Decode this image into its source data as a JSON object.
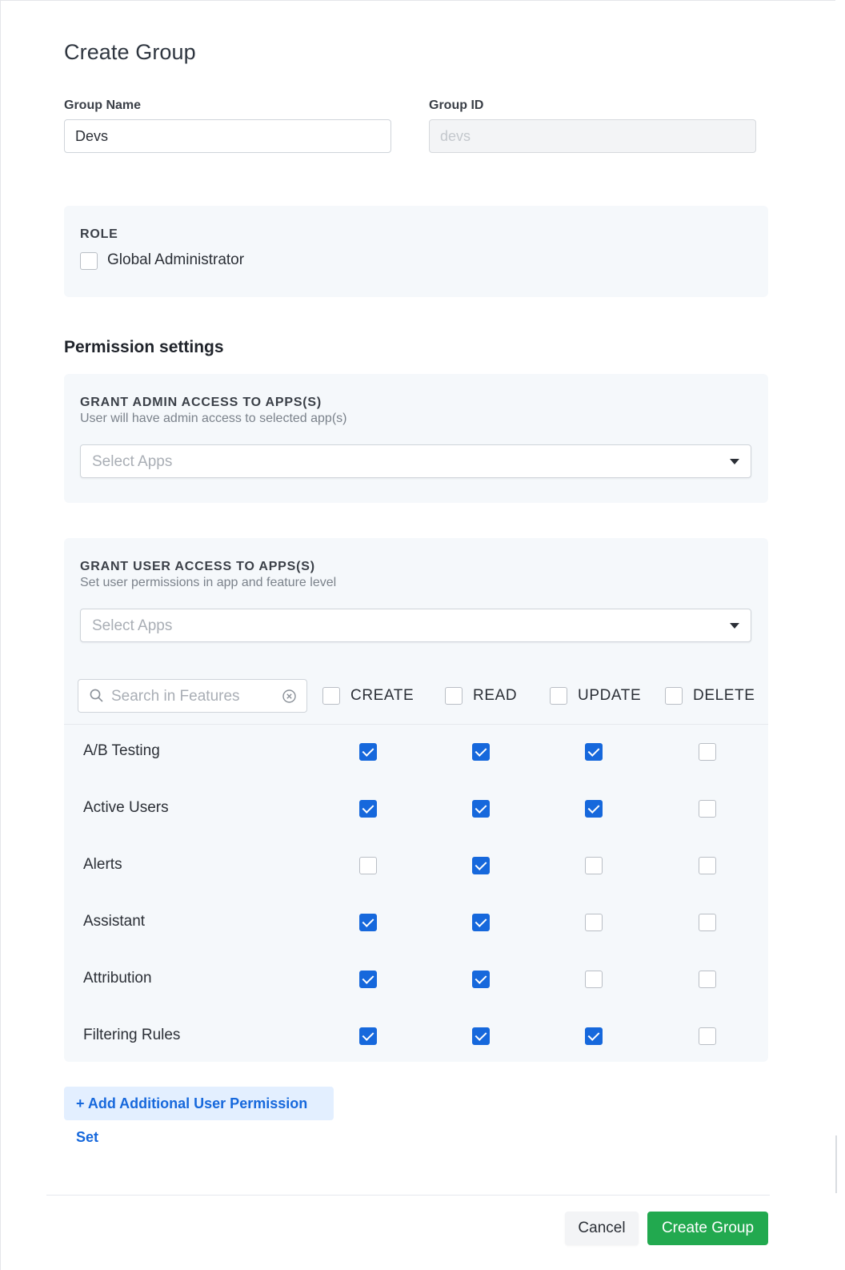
{
  "form": {
    "title": "Create Group",
    "group_name": {
      "label": "Group Name",
      "value": "Devs"
    },
    "group_id": {
      "label": "Group ID",
      "placeholder": "devs"
    }
  },
  "role": {
    "label": "ROLE",
    "options": [
      {
        "label": "Global Administrator",
        "checked": false
      }
    ]
  },
  "permissions": {
    "title": "Permission settings",
    "admin_access": {
      "label": "GRANT ADMIN ACCESS TO APPS(S)",
      "description": "User will have admin access to selected app(s)",
      "select_placeholder": "Select Apps"
    },
    "user_access": {
      "label": "GRANT USER ACCESS TO APPS(S)",
      "description": "Set user permissions in app and feature level",
      "select_placeholder": "Select Apps",
      "search_placeholder": "Search in Features",
      "columns": [
        "CREATE",
        "READ",
        "UPDATE",
        "DELETE"
      ],
      "features": [
        {
          "name": "A/B Testing",
          "perms": [
            true,
            true,
            true,
            false
          ]
        },
        {
          "name": "Active Users",
          "perms": [
            true,
            true,
            true,
            false
          ]
        },
        {
          "name": "Alerts",
          "perms": [
            false,
            true,
            false,
            false
          ]
        },
        {
          "name": "Assistant",
          "perms": [
            true,
            true,
            false,
            false
          ]
        },
        {
          "name": "Attribution",
          "perms": [
            true,
            true,
            false,
            false
          ]
        },
        {
          "name": "Filtering Rules",
          "perms": [
            true,
            true,
            true,
            false
          ]
        }
      ]
    },
    "add_set_label": "+ Add Additional User Permission Set"
  },
  "footer": {
    "cancel_label": "Cancel",
    "create_label": "Create Group"
  },
  "colors": {
    "accent": "#1668dc",
    "primary_button": "#22a94f",
    "panel_bg": "#f5f8fb"
  },
  "icons": [
    "search-icon",
    "clear-icon",
    "chevron-down-icon",
    "checkbox-icon"
  ]
}
